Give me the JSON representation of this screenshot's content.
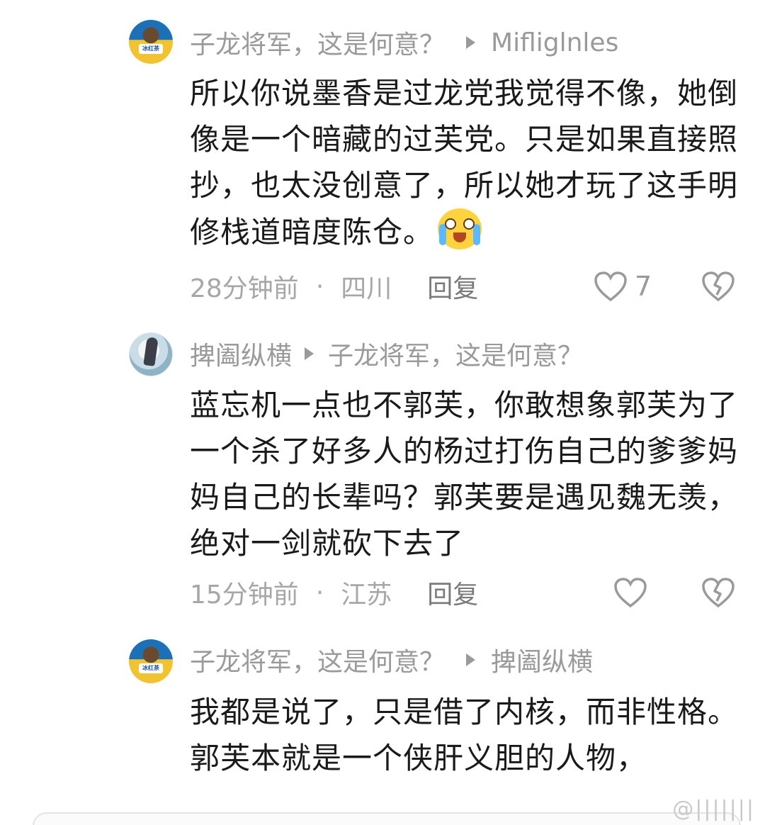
{
  "comments": [
    {
      "author": "子龙将军，这是何意？",
      "reply_to": "Mifliglnles",
      "text": "所以你说墨香是过龙党我觉得不像，她倒像是一个暗藏的过芙党。只是如果直接照抄，也太没创意了，所以她才玩了这手明修栈道暗度陈仓。",
      "emoji": "crying-laughing-emoji",
      "time": "28分钟前",
      "location": "四川",
      "reply_label": "回复",
      "likes": "7"
    },
    {
      "author": "捭阖纵横",
      "reply_to": "子龙将军，这是何意？",
      "text": "蓝忘机一点也不郭芙，你敢想象郭芙为了一个杀了好多人的杨过打伤自己的爹爹妈妈自己的长辈吗？郭芙要是遇见魏无羡，绝对一剑就砍下去了",
      "time": "15分钟前",
      "location": "江苏",
      "reply_label": "回复",
      "likes": ""
    },
    {
      "author": "子龙将军，这是何意？",
      "reply_to": "捭阖纵横",
      "text": "我都是说了，只是借了内核，而非性格。郭芙本就是一个侠肝义胆的人物，"
    }
  ],
  "avatar_badge": "冰红茶",
  "separator": "·",
  "watermark": "@|||||||",
  "colors": {
    "text": "#1a1a1a",
    "meta": "#9a9a9a",
    "background": "#ffffff"
  }
}
